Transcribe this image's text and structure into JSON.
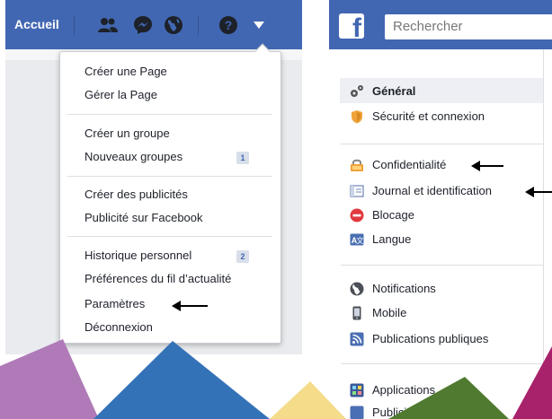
{
  "left": {
    "home_label": "Accueil",
    "menu": {
      "groups": [
        [
          {
            "label": "Créer une Page"
          },
          {
            "label": "Gérer la Page"
          }
        ],
        [
          {
            "label": "Créer un groupe"
          },
          {
            "label": "Nouveaux groupes",
            "badge": "1"
          }
        ],
        [
          {
            "label": "Créer des publicités"
          },
          {
            "label": "Publicité sur Facebook"
          }
        ],
        [
          {
            "label": "Historique personnel",
            "badge": "2"
          },
          {
            "label": "Préférences du fil d’actualité"
          },
          {
            "label": "Paramètres"
          },
          {
            "label": "Déconnexion"
          }
        ]
      ]
    }
  },
  "right": {
    "logo_letter": "f",
    "search_placeholder": "Rechercher",
    "items": [
      {
        "label": "Général",
        "icon": "gears-icon"
      },
      {
        "label": "Sécurité et connexion",
        "icon": "shield-icon"
      },
      {
        "label": "Confidentialité",
        "icon": "lock-icon"
      },
      {
        "label": "Journal et identification",
        "icon": "timeline-icon"
      },
      {
        "label": "Blocage",
        "icon": "block-icon"
      },
      {
        "label": "Langue",
        "icon": "language-icon"
      },
      {
        "label": "Notifications",
        "icon": "globe-icon"
      },
      {
        "label": "Mobile",
        "icon": "mobile-icon"
      },
      {
        "label": "Publications publiques",
        "icon": "rss-icon"
      },
      {
        "label": "Applications",
        "icon": "apps-icon"
      },
      {
        "label": "Publicités",
        "icon": "ads-icon"
      }
    ]
  },
  "colors": {
    "facebook_blue": "#4267b2",
    "decor_purple": "#b07ab8",
    "decor_blue": "#3472b8",
    "decor_yellow": "#f4dc8a",
    "decor_green": "#4f7a2f",
    "decor_magenta": "#a8216b"
  }
}
